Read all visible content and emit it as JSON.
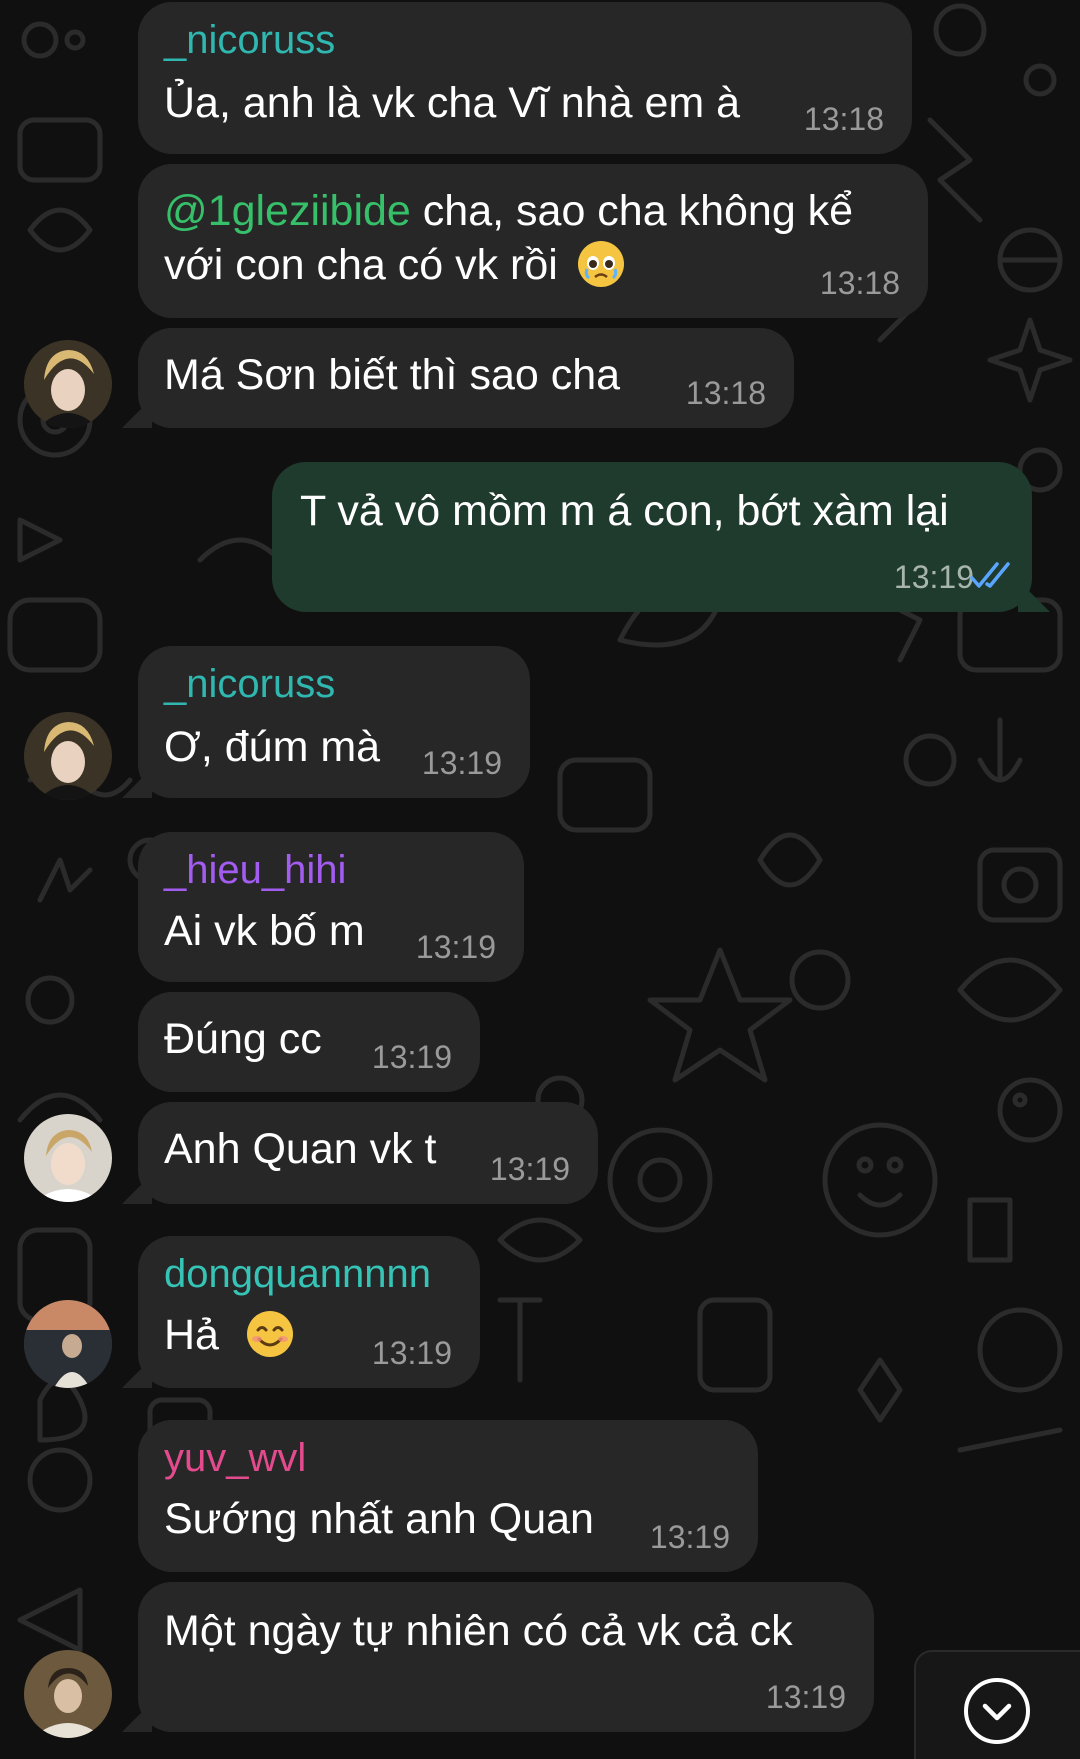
{
  "colors": {
    "incoming_bubble": "#272727",
    "outgoing_bubble": "#1f3b2e",
    "name_nicoruss": "#2fb7b0",
    "name_hieu": "#a35cf0",
    "name_dongquan": "#35c4b6",
    "name_yuv": "#e44b8e",
    "mention": "#37c06a",
    "read_checks": "#5aa6ff"
  },
  "messages": [
    {
      "sender": "_nicoruss",
      "text": "Ủa, anh là vk cha Vĩ nhà em à",
      "time": "13:18"
    },
    {
      "mention": "@1gleziibide",
      "text_line1": " cha, sao cha không kể",
      "text_line2": "với con cha có vk rồi",
      "emoji": "crying-face",
      "time": "13:18"
    },
    {
      "text": "Má Sơn biết thì sao cha",
      "time": "13:18"
    },
    {
      "text": "T vả vô mồm m á con, bớt xàm lại",
      "time": "13:19",
      "status": "read"
    },
    {
      "sender": "_nicoruss",
      "text": "Ơ, đúm mà",
      "time": "13:19"
    },
    {
      "sender": "_hieu_hihi",
      "text": "Ai vk bố m",
      "time": "13:19"
    },
    {
      "text": "Đúng cc",
      "time": "13:19"
    },
    {
      "text": "Anh Quan vk t",
      "time": "13:19"
    },
    {
      "sender": "dongquannnnn",
      "text": "Hả",
      "emoji": "smiling-face",
      "time": "13:19"
    },
    {
      "sender": "yuv_wvl",
      "text": "Sướng nhất anh Quan",
      "time": "13:19"
    },
    {
      "text": "Một ngày tự nhiên có cả vk cả ck",
      "time": "13:19"
    }
  ],
  "icons": {
    "read_receipt": "double-check-icon",
    "scroll_down": "chevron-down-icon"
  }
}
